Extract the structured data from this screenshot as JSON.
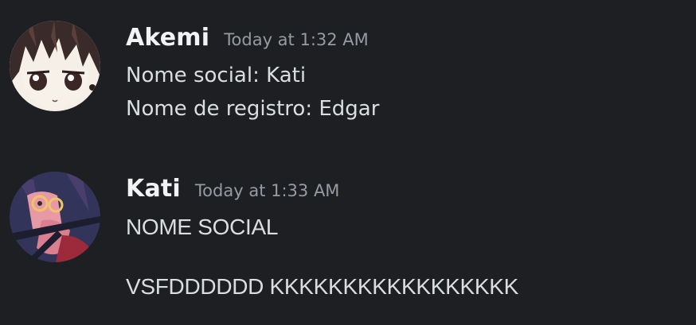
{
  "messages": [
    {
      "author": "Akemi",
      "timestamp": "Today at 1:32 AM",
      "avatar_icon": "anime-girl-dark-hair-avatar",
      "lines": [
        "Nome social: Kati",
        "Nome de registro: Edgar"
      ]
    },
    {
      "author": "Kati",
      "timestamp": "Today at 1:33 AM",
      "avatar_icon": "anime-character-pink-avatar",
      "lines": [
        "NOME SOCIAL",
        "VSFDDDDDD KKKKKKKKKKKKKKKKK"
      ]
    }
  ],
  "colors": {
    "background": "#1e1f22",
    "username": "#f2f3f5",
    "timestamp": "#949ba4",
    "message_text": "#dbdee1"
  }
}
